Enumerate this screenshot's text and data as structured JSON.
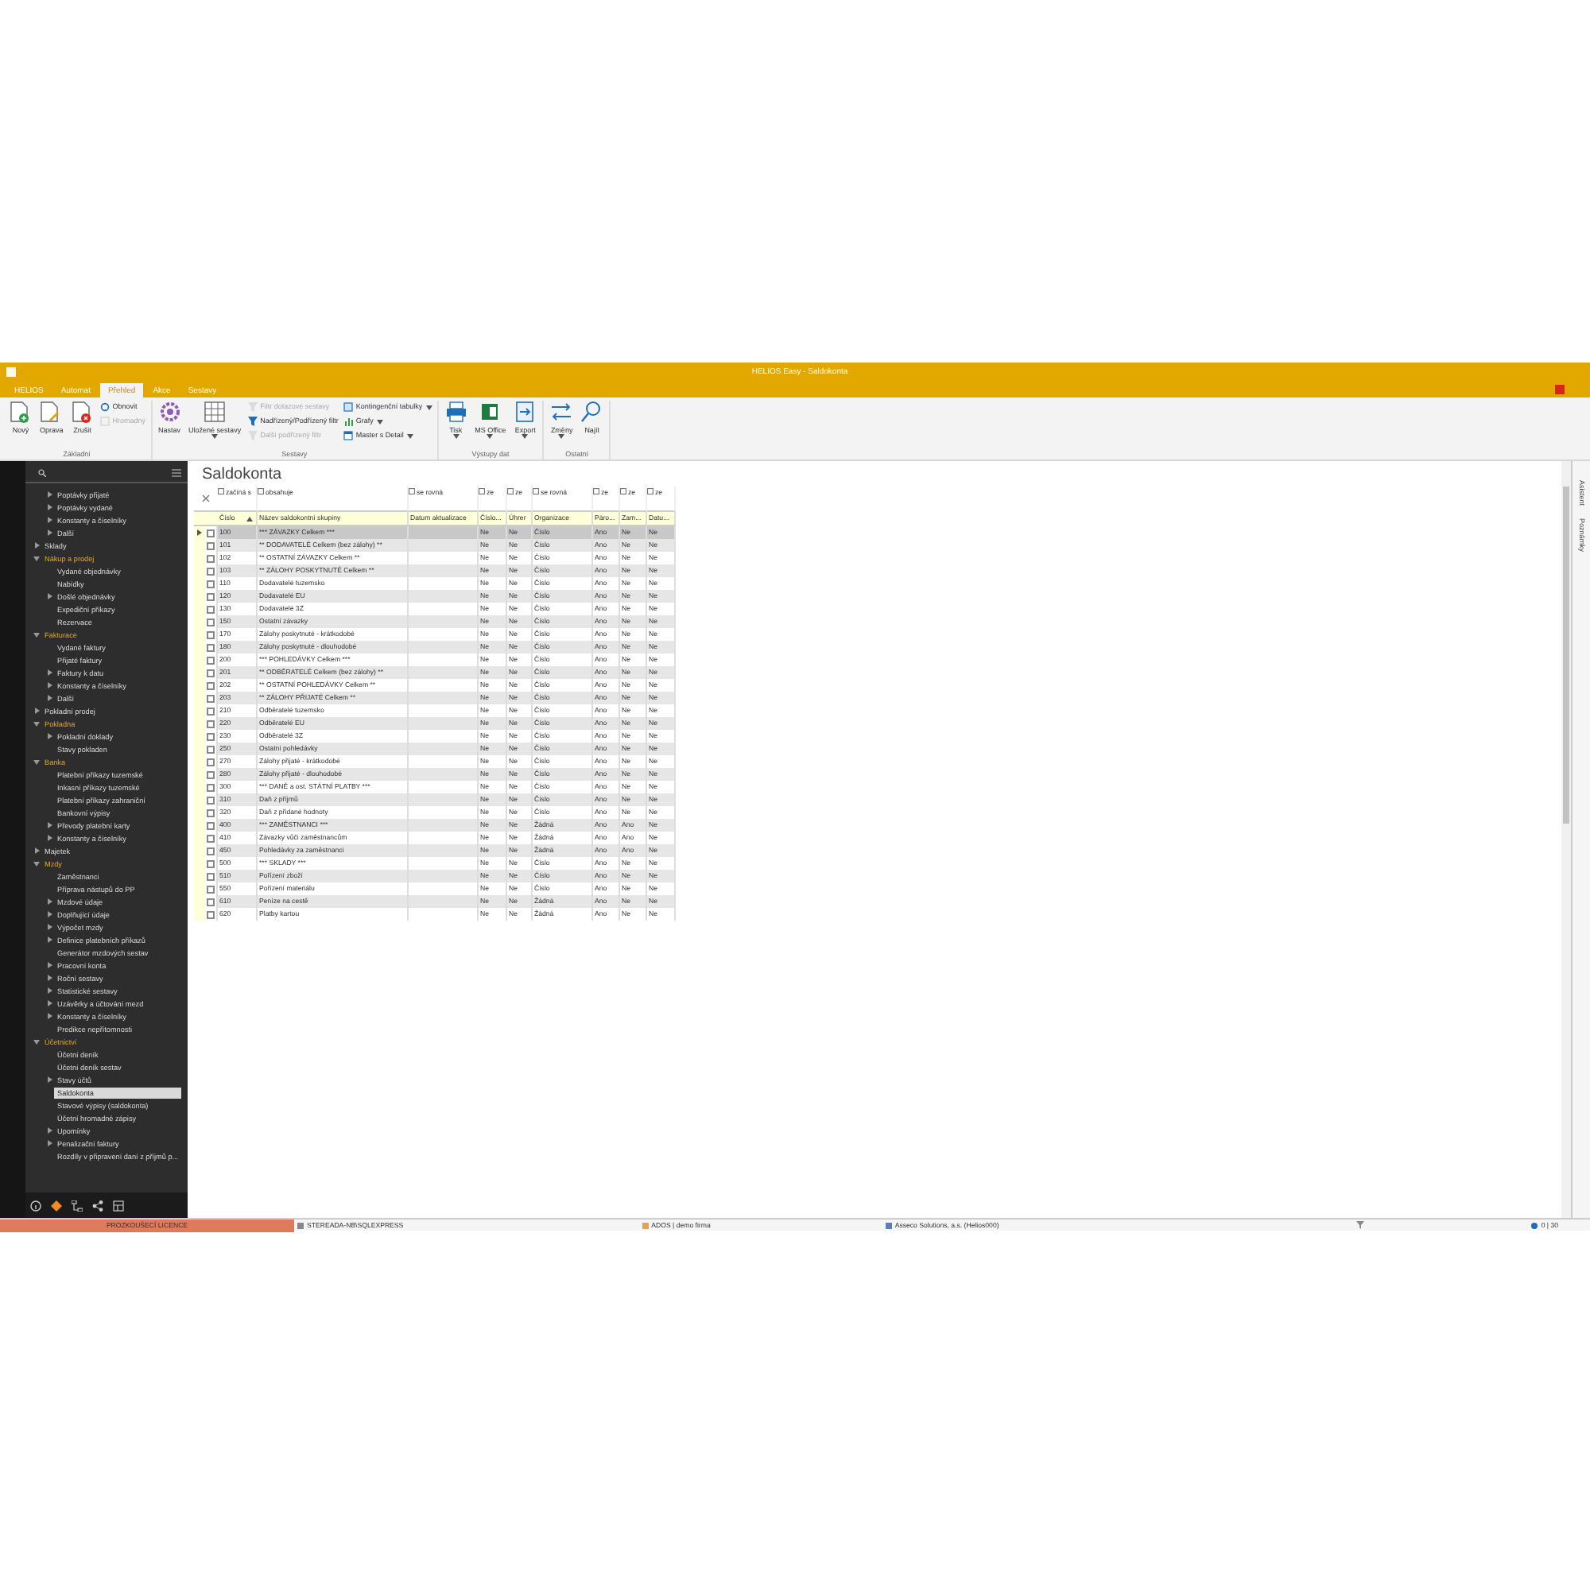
{
  "window": {
    "title": "HELIOS Easy - Saldokonta"
  },
  "ribbon_tabs": [
    {
      "label": "HELIOS",
      "selected": false
    },
    {
      "label": "Automat",
      "selected": false
    },
    {
      "label": "Přehled",
      "selected": true
    },
    {
      "label": "Akce",
      "selected": false
    },
    {
      "label": "Sestavy",
      "selected": false
    }
  ],
  "ribbon_groups": [
    {
      "title": "Základní",
      "items": [
        {
          "label": "Nový",
          "kind": "large",
          "disabled": false,
          "has_menu": false
        },
        {
          "label": "Oprava",
          "kind": "large",
          "disabled": false,
          "has_menu": false
        },
        {
          "label": "Zrušit",
          "kind": "large",
          "disabled": false,
          "has_menu": false
        },
        {
          "label": "Obnovit",
          "kind": "small",
          "disabled": false,
          "has_menu": false
        },
        {
          "label": "Hromadný",
          "kind": "small",
          "disabled": true,
          "has_menu": false
        }
      ]
    },
    {
      "title": "Sestavy",
      "items": [
        {
          "label": "Nastav",
          "kind": "large",
          "disabled": false,
          "has_menu": false
        },
        {
          "label": "Uložené sestavy",
          "kind": "large",
          "disabled": false,
          "has_menu": true
        },
        {
          "label": "Filtr dotazové sestavy",
          "kind": "small",
          "disabled": true,
          "has_menu": false
        },
        {
          "label": "Nadřízený/Podřízený filtr",
          "kind": "small",
          "disabled": false,
          "has_menu": false
        },
        {
          "label": "Další podřízený filtr",
          "kind": "small",
          "disabled": true,
          "has_menu": false
        },
        {
          "label": "Kontingenční tabulky",
          "kind": "small",
          "disabled": false,
          "has_menu": true
        },
        {
          "label": "Grafy",
          "kind": "small",
          "disabled": false,
          "has_menu": true
        },
        {
          "label": "Master s Detail",
          "kind": "small",
          "disabled": false,
          "has_menu": true
        }
      ]
    },
    {
      "title": "Výstupy dat",
      "items": [
        {
          "label": "Tisk",
          "kind": "large",
          "disabled": false,
          "has_menu": true
        },
        {
          "label": "MS Office",
          "kind": "large",
          "disabled": false,
          "has_menu": true
        },
        {
          "label": "Export",
          "kind": "large",
          "disabled": false,
          "has_menu": true
        }
      ]
    },
    {
      "title": "Ostatní",
      "items": [
        {
          "label": "Změny",
          "kind": "large",
          "disabled": false,
          "has_menu": true
        },
        {
          "label": "Najít",
          "kind": "large",
          "disabled": false,
          "has_menu": false
        }
      ]
    }
  ],
  "sidebar": {
    "tree": [
      {
        "children": [
          {
            "label": "Poptávky přijaté",
            "selected": false,
            "expanded": false
          },
          {
            "label": "Poptávky vydané",
            "selected": false,
            "expanded": false
          },
          {
            "label": "Konstanty a číselníky",
            "selected": false,
            "expanded": false
          },
          {
            "label": "Další",
            "selected": false,
            "expanded": false
          }
        ]
      },
      {
        "label": "Sklady",
        "selected": false,
        "expanded": false
      },
      {
        "label": "Nákup a prodej",
        "selected": false,
        "expanded": true,
        "children": [
          {
            "label": "Vydané objednávky",
            "selected": false
          },
          {
            "label": "Nabídky",
            "selected": false
          },
          {
            "label": "Došlé objednávky",
            "selected": false,
            "expanded": false
          },
          {
            "label": "Expediční příkazy",
            "selected": false
          },
          {
            "label": "Rezervace",
            "selected": false
          }
        ]
      },
      {
        "label": "Fakturace",
        "selected": false,
        "expanded": true,
        "children": [
          {
            "label": "Vydané faktury",
            "selected": false
          },
          {
            "label": "Přijaté faktury",
            "selected": false
          },
          {
            "label": "Faktury k datu",
            "selected": false,
            "expanded": false
          },
          {
            "label": "Konstanty a číselníky",
            "selected": false,
            "expanded": false
          },
          {
            "label": "Další",
            "selected": false,
            "expanded": false
          }
        ]
      },
      {
        "label": "Pokladní prodej",
        "selected": false,
        "expanded": false
      },
      {
        "label": "Pokladna",
        "selected": false,
        "expanded": true,
        "children": [
          {
            "label": "Pokladní doklady",
            "selected": false,
            "expanded": false
          },
          {
            "label": "Stavy pokladen",
            "selected": false
          }
        ]
      },
      {
        "label": "Banka",
        "selected": false,
        "expanded": true,
        "children": [
          {
            "label": "Platební příkazy tuzemské",
            "selected": false
          },
          {
            "label": "Inkasní příkazy tuzemské",
            "selected": false
          },
          {
            "label": "Platební příkazy zahraniční",
            "selected": false
          },
          {
            "label": "Bankovní výpisy",
            "selected": false
          },
          {
            "label": "Převody platební karty",
            "selected": false,
            "expanded": false
          },
          {
            "label": "Konstanty a číselníky",
            "selected": false,
            "expanded": false
          }
        ]
      },
      {
        "label": "Majetek",
        "selected": false,
        "expanded": false
      },
      {
        "label": "Mzdy",
        "selected": false,
        "expanded": true,
        "children": [
          {
            "label": "Zaměstnanci",
            "selected": false
          },
          {
            "label": "Příprava nástupů do PP",
            "selected": false
          },
          {
            "label": "Mzdové údaje",
            "selected": false,
            "expanded": false
          },
          {
            "label": "Doplňující údaje",
            "selected": false,
            "expanded": false
          },
          {
            "label": "Výpočet mzdy",
            "selected": false,
            "expanded": false
          },
          {
            "label": "Definice platebních příkazů",
            "selected": false,
            "expanded": false
          },
          {
            "label": "Generátor mzdových sestav",
            "selected": false
          },
          {
            "label": "Pracovní konta",
            "selected": false,
            "expanded": false
          },
          {
            "label": "Roční sestavy",
            "selected": false,
            "expanded": false
          },
          {
            "label": "Statistické sestavy",
            "selected": false,
            "expanded": false
          },
          {
            "label": "Uzávěrky a účtování mezd",
            "selected": false,
            "expanded": false
          },
          {
            "label": "Konstanty a číselníky",
            "selected": false,
            "expanded": false
          },
          {
            "label": "Predikce nepřítomnosti",
            "selected": false
          }
        ]
      },
      {
        "label": "Účetnictví",
        "selected": false,
        "expanded": true,
        "children": [
          {
            "label": "Účetní deník",
            "selected": false
          },
          {
            "label": "Účetní deník sestav",
            "selected": false
          },
          {
            "label": "Stavy účtů",
            "selected": false,
            "expanded": false
          },
          {
            "label": "Saldokonta",
            "selected": true
          },
          {
            "label": "Stavové výpisy (saldokonta)",
            "selected": false
          },
          {
            "label": "Účetní hromadné zápisy",
            "selected": false
          },
          {
            "label": "Upomínky",
            "selected": false,
            "expanded": false
          },
          {
            "label": "Penalizační faktury",
            "selected": false,
            "expanded": false
          },
          {
            "label": "Rozdíly v připravení daní z příjmů p...",
            "selected": false
          }
        ]
      }
    ]
  },
  "page_title": "Saldokonta",
  "table": {
    "filters": [
      "začíná s",
      "obsahuje",
      "se rovná",
      "ze",
      "ze",
      "se rovná",
      "ze",
      "ze",
      "ze"
    ],
    "columns": [
      "Číslo",
      "Název saldokontní skupiny",
      "Datum aktualizace",
      "Číslo...",
      "Úhrer",
      "Organizace",
      "Páro...",
      "Zam...",
      "Datu..."
    ],
    "rows": [
      {
        "selected": true,
        "checked": false,
        "cells": [
          "100",
          "*** ZÁVAZKY Celkem ***",
          "",
          "Ne",
          "Ne",
          "Číslo",
          "Ano",
          "Ne",
          "Ne"
        ]
      },
      {
        "selected": false,
        "checked": false,
        "cells": [
          "101",
          "** DODAVATELÉ Celkem (bez zálohy) **",
          "",
          "Ne",
          "Ne",
          "Číslo",
          "Ano",
          "Ne",
          "Ne"
        ]
      },
      {
        "selected": false,
        "checked": false,
        "cells": [
          "102",
          "** OSTATNÍ ZÁVAZKY Celkem **",
          "",
          "Ne",
          "Ne",
          "Číslo",
          "Ano",
          "Ne",
          "Ne"
        ]
      },
      {
        "selected": false,
        "checked": false,
        "cells": [
          "103",
          "** ZÁLOHY POSKYTNUTÉ Celkem **",
          "",
          "Ne",
          "Ne",
          "Číslo",
          "Ano",
          "Ne",
          "Ne"
        ]
      },
      {
        "selected": false,
        "checked": false,
        "cells": [
          "110",
          "Dodavatelé tuzemsko",
          "",
          "Ne",
          "Ne",
          "Číslo",
          "Ano",
          "Ne",
          "Ne"
        ]
      },
      {
        "selected": false,
        "checked": false,
        "cells": [
          "120",
          "Dodavatelé EU",
          "",
          "Ne",
          "Ne",
          "Číslo",
          "Ano",
          "Ne",
          "Ne"
        ]
      },
      {
        "selected": false,
        "checked": false,
        "cells": [
          "130",
          "Dodavatelé 3Z",
          "",
          "Ne",
          "Ne",
          "Číslo",
          "Ano",
          "Ne",
          "Ne"
        ]
      },
      {
        "selected": false,
        "checked": false,
        "cells": [
          "150",
          "Ostatní závazky",
          "",
          "Ne",
          "Ne",
          "Číslo",
          "Ano",
          "Ne",
          "Ne"
        ]
      },
      {
        "selected": false,
        "checked": false,
        "cells": [
          "170",
          "Zálohy poskytnuté - krátkodobé",
          "",
          "Ne",
          "Ne",
          "Číslo",
          "Ano",
          "Ne",
          "Ne"
        ]
      },
      {
        "selected": false,
        "checked": false,
        "cells": [
          "180",
          "Zálohy poskytnuté - dlouhodobé",
          "",
          "Ne",
          "Ne",
          "Číslo",
          "Ano",
          "Ne",
          "Ne"
        ]
      },
      {
        "selected": false,
        "checked": false,
        "cells": [
          "200",
          "*** POHLEDÁVKY Celkem ***",
          "",
          "Ne",
          "Ne",
          "Číslo",
          "Ano",
          "Ne",
          "Ne"
        ]
      },
      {
        "selected": false,
        "checked": false,
        "cells": [
          "201",
          "** ODBĚRATELÉ Celkem (bez zálohy) **",
          "",
          "Ne",
          "Ne",
          "Číslo",
          "Ano",
          "Ne",
          "Ne"
        ]
      },
      {
        "selected": false,
        "checked": false,
        "cells": [
          "202",
          "** OSTATNÍ POHLEDÁVKY Celkem **",
          "",
          "Ne",
          "Ne",
          "Číslo",
          "Ano",
          "Ne",
          "Ne"
        ]
      },
      {
        "selected": false,
        "checked": false,
        "cells": [
          "203",
          "** ZÁLOHY PŘIJATÉ Celkem **",
          "",
          "Ne",
          "Ne",
          "Číslo",
          "Ano",
          "Ne",
          "Ne"
        ]
      },
      {
        "selected": false,
        "checked": false,
        "cells": [
          "210",
          "Odběratelé tuzemsko",
          "",
          "Ne",
          "Ne",
          "Číslo",
          "Ano",
          "Ne",
          "Ne"
        ]
      },
      {
        "selected": false,
        "checked": false,
        "cells": [
          "220",
          "Odběratelé EU",
          "",
          "Ne",
          "Ne",
          "Číslo",
          "Ano",
          "Ne",
          "Ne"
        ]
      },
      {
        "selected": false,
        "checked": false,
        "cells": [
          "230",
          "Odběratelé 3Z",
          "",
          "Ne",
          "Ne",
          "Číslo",
          "Ano",
          "Ne",
          "Ne"
        ]
      },
      {
        "selected": false,
        "checked": false,
        "cells": [
          "250",
          "Ostatní pohledávky",
          "",
          "Ne",
          "Ne",
          "Číslo",
          "Ano",
          "Ne",
          "Ne"
        ]
      },
      {
        "selected": false,
        "checked": false,
        "cells": [
          "270",
          "Zálohy přijaté - krátkodobé",
          "",
          "Ne",
          "Ne",
          "Číslo",
          "Ano",
          "Ne",
          "Ne"
        ]
      },
      {
        "selected": false,
        "checked": false,
        "cells": [
          "280",
          "Zálohy přijaté - dlouhodobé",
          "",
          "Ne",
          "Ne",
          "Číslo",
          "Ano",
          "Ne",
          "Ne"
        ]
      },
      {
        "selected": false,
        "checked": false,
        "cells": [
          "300",
          "*** DANĚ a ost. STÁTNÍ PLATBY ***",
          "",
          "Ne",
          "Ne",
          "Číslo",
          "Ano",
          "Ne",
          "Ne"
        ]
      },
      {
        "selected": false,
        "checked": false,
        "cells": [
          "310",
          "Daň z příjmů",
          "",
          "Ne",
          "Ne",
          "Číslo",
          "Ano",
          "Ne",
          "Ne"
        ]
      },
      {
        "selected": false,
        "checked": false,
        "cells": [
          "320",
          "Daň z přidané hodnoty",
          "",
          "Ne",
          "Ne",
          "Číslo",
          "Ano",
          "Ne",
          "Ne"
        ]
      },
      {
        "selected": false,
        "checked": false,
        "cells": [
          "400",
          "*** ZAMĚSTNANCI ***",
          "",
          "Ne",
          "Ne",
          "Žádná",
          "Ano",
          "Ano",
          "Ne"
        ]
      },
      {
        "selected": false,
        "checked": false,
        "cells": [
          "410",
          "Závazky vůči zaměstnancům",
          "",
          "Ne",
          "Ne",
          "Žádná",
          "Ano",
          "Ano",
          "Ne"
        ]
      },
      {
        "selected": false,
        "checked": false,
        "cells": [
          "450",
          "Pohledávky za zaměstnanci",
          "",
          "Ne",
          "Ne",
          "Žádná",
          "Ano",
          "Ano",
          "Ne"
        ]
      },
      {
        "selected": false,
        "checked": false,
        "cells": [
          "500",
          "*** SKLADY ***",
          "",
          "Ne",
          "Ne",
          "Číslo",
          "Ano",
          "Ne",
          "Ne"
        ]
      },
      {
        "selected": false,
        "checked": false,
        "cells": [
          "510",
          "Pořízení zboží",
          "",
          "Ne",
          "Ne",
          "Číslo",
          "Ano",
          "Ne",
          "Ne"
        ]
      },
      {
        "selected": false,
        "checked": false,
        "cells": [
          "550",
          "Pořízení materiálu",
          "",
          "Ne",
          "Ne",
          "Číslo",
          "Ano",
          "Ne",
          "Ne"
        ]
      },
      {
        "selected": false,
        "checked": false,
        "cells": [
          "610",
          "Peníze na cestě",
          "",
          "Ne",
          "Ne",
          "Žádná",
          "Ano",
          "Ne",
          "Ne"
        ]
      },
      {
        "selected": false,
        "checked": false,
        "cells": [
          "620",
          "Platby kartou",
          "",
          "Ne",
          "Ne",
          "Žádná",
          "Ano",
          "Ne",
          "Ne"
        ]
      }
    ]
  },
  "side_tabs": [
    "Asistent",
    "Poznámky"
  ],
  "status_bar": {
    "license": "PROZKOUŠECÍ LICENCE",
    "server": "STEREADA-NB\\SQLEXPRESS",
    "database": "ADOS | demo firma",
    "company": "Asseco Solutions, a.s. (Helios000)",
    "count": "0 | 30"
  }
}
